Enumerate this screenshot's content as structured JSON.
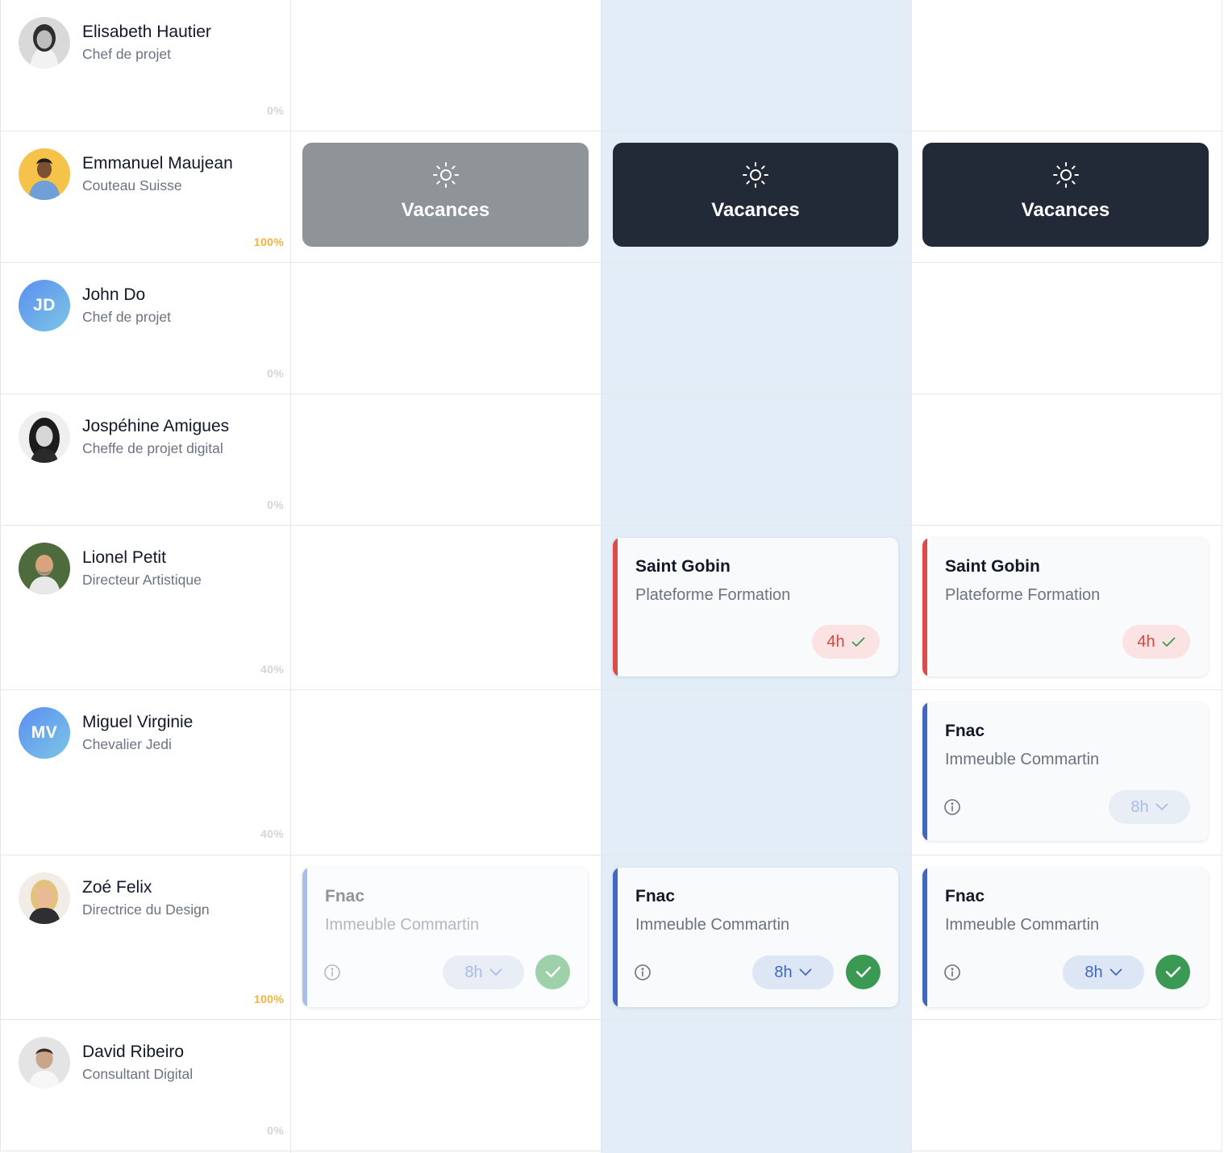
{
  "people": [
    {
      "name": "Elisabeth Hautier",
      "role": "Chef de projet",
      "load": "0%"
    },
    {
      "name": "Emmanuel Maujean",
      "role": "Couteau Suisse",
      "load": "100%"
    },
    {
      "name": "John Do",
      "role": "Chef de projet",
      "load": "0%",
      "initials": "JD"
    },
    {
      "name": "Jospéhine Amigues",
      "role": "Cheffe de projet digital",
      "load": "0%"
    },
    {
      "name": "Lionel Petit",
      "role": "Directeur Artistique",
      "load": "40%"
    },
    {
      "name": "Miguel Virginie",
      "role": "Chevalier Jedi",
      "load": "40%",
      "initials": "MV"
    },
    {
      "name": "Zoé Felix",
      "role": "Directrice du Design",
      "load": "100%"
    },
    {
      "name": "David Ribeiro",
      "role": "Consultant Digital",
      "load": "0%"
    }
  ],
  "vacation": {
    "label": "Vacances",
    "icon": "sun-icon"
  },
  "assignments": {
    "lionel": [
      {
        "client": "Saint Gobin",
        "project": "Plateforme Formation",
        "hours": "4h"
      },
      {
        "client": "Saint Gobin",
        "project": "Plateforme Formation",
        "hours": "4h"
      }
    ],
    "miguel": [
      {
        "client": "Fnac",
        "project": "Immeuble Commartin",
        "hours": "8h"
      }
    ],
    "zoe": [
      {
        "client": "Fnac",
        "project": "Immeuble Commartin",
        "hours": "8h"
      },
      {
        "client": "Fnac",
        "project": "Immeuble Commartin",
        "hours": "8h"
      },
      {
        "client": "Fnac",
        "project": "Immeuble Commartin",
        "hours": "8h"
      }
    ]
  },
  "colors": {
    "today_column": "#e3edf7",
    "vacation_past": "#8f9499",
    "vacation_current": "#232a37",
    "accent_red": "#dc4a4a",
    "accent_blue": "#4068c0",
    "confirm_green": "#3a9a54",
    "load_full": "#f0b43c"
  }
}
